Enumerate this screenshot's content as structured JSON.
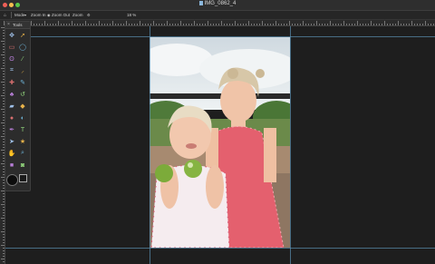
{
  "window": {
    "title": "IMG_0862_4"
  },
  "options_bar": {
    "home_icon": "home-icon",
    "mode_label": "Mode",
    "zoom_in_label": "Zoom In",
    "zoom_out_label": "Zoom Out",
    "zoom_label": "Zoom",
    "zoom_value": "18 %"
  },
  "tools_panel": {
    "title": "Tools",
    "tools": [
      "move-icon",
      "direct-select-icon",
      "rect-marquee-icon",
      "ellipse-marquee-icon",
      "lasso-icon",
      "magic-wand-icon",
      "crop-icon",
      "eyedropper-icon",
      "healing-icon",
      "brush-icon",
      "clone-stamp-icon",
      "history-brush-icon",
      "eraser-icon",
      "fill-icon",
      "blur-icon",
      "dodge-icon",
      "pen-icon",
      "type-icon",
      "path-select-icon",
      "shape-icon",
      "hand-icon",
      "zoom-icon",
      "foreground-color-icon",
      "quick-mask-icon"
    ]
  },
  "colors": {
    "guide": "#5a8fb0",
    "canvas": "#1e1e1e",
    "panel": "#2c2c2c"
  }
}
